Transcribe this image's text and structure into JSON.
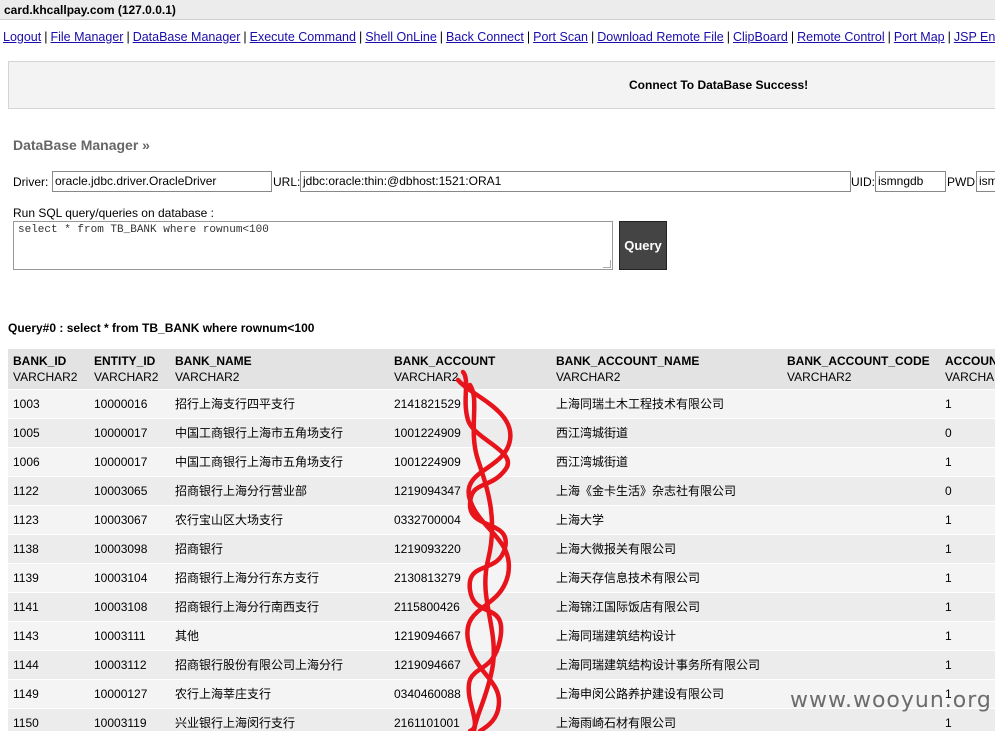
{
  "window": {
    "title": "card.khcallpay.com (127.0.0.1)"
  },
  "nav": [
    "Logout",
    "File Manager",
    "DataBase Manager",
    "Execute Command",
    "Shell OnLine",
    "Back Connect",
    "Port Scan",
    "Download Remote File",
    "ClipBoard",
    "Remote Control",
    "Port Map",
    "JSP Env"
  ],
  "message": "Connect To DataBase Success!",
  "db": {
    "title": "DataBase Manager »",
    "driver_label": "Driver:",
    "driver_value": "oracle.jdbc.driver.OracleDriver",
    "url_label": "URL:",
    "url_value": "jdbc:oracle:thin:@dbhost:1521:ORA1",
    "uid_label": "UID:",
    "uid_value": "ismngdb",
    "pwd_label": "PWD:",
    "pwd_value": "ism",
    "sql_label": "Run SQL query/queries on database :",
    "sql_value": "select * from TB_BANK where rownum<100",
    "query_button": "Query"
  },
  "result": {
    "title": "Query#0 : select * from TB_BANK where rownum<100",
    "columns": [
      {
        "name": "BANK_ID",
        "type": "VARCHAR2"
      },
      {
        "name": "ENTITY_ID",
        "type": "VARCHAR2"
      },
      {
        "name": "BANK_NAME",
        "type": "VARCHAR2"
      },
      {
        "name": "BANK_ACCOUNT",
        "type": "VARCHAR2"
      },
      {
        "name": "BANK_ACCOUNT_NAME",
        "type": "VARCHAR2"
      },
      {
        "name": "BANK_ACCOUNT_CODE",
        "type": "VARCHAR2"
      },
      {
        "name": "ACCOUN",
        "type": "VARCHA"
      }
    ],
    "rows": [
      [
        "1003",
        "10000016",
        "招行上海支行四平支行",
        "2141821529",
        "上海同瑞土木工程技术有限公司",
        "",
        "1"
      ],
      [
        "1005",
        "10000017",
        "中国工商银行上海市五角场支行",
        "1001224909",
        "西江湾城街道",
        "",
        "0"
      ],
      [
        "1006",
        "10000017",
        "中国工商银行上海市五角场支行",
        "1001224909",
        "西江湾城街道",
        "",
        "1"
      ],
      [
        "1122",
        "10003065",
        "招商银行上海分行营业部",
        "1219094347",
        "上海《金卡生活》杂志社有限公司",
        "",
        "0"
      ],
      [
        "1123",
        "10003067",
        "农行宝山区大场支行",
        "0332700004",
        "上海大学",
        "",
        "1"
      ],
      [
        "1138",
        "10003098",
        "招商银行",
        "1219093220",
        "上海大微报关有限公司",
        "",
        "1"
      ],
      [
        "1139",
        "10003104",
        "招商银行上海分行东方支行",
        "2130813279",
        "上海天存信息技术有限公司",
        "",
        "1"
      ],
      [
        "1141",
        "10003108",
        "招商银行上海分行南西支行",
        "2115800426",
        "上海锦江国际饭店有限公司",
        "",
        "1"
      ],
      [
        "1143",
        "10003111",
        "其他",
        "1219094667",
        "上海同瑞建筑结构设计",
        "",
        "1"
      ],
      [
        "1144",
        "10003112",
        "招商银行股份有限公司上海分行",
        "1219094667",
        "上海同瑞建筑结构设计事务所有限公司",
        "",
        "1"
      ],
      [
        "1149",
        "10000127",
        "农行上海莘庄支行",
        "0340460088",
        "上海申闵公路养护建设有限公司",
        "",
        "1"
      ],
      [
        "1150",
        "10003119",
        "兴业银行上海闵行支行",
        "2161101001",
        "上海雨崎石材有限公司",
        "",
        "1"
      ]
    ]
  },
  "watermark": "www.wooyun.org",
  "colors": {
    "link": "#1a0dab",
    "scribble": "#e8141c",
    "button": "#444444"
  }
}
